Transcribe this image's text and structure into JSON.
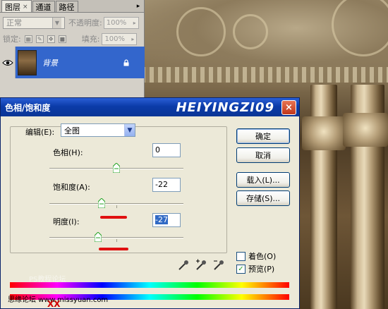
{
  "layers_panel": {
    "tabs": [
      {
        "label": "图层",
        "close": "×"
      },
      {
        "label": "通道"
      },
      {
        "label": "路径"
      }
    ],
    "blend_mode": "正常",
    "opacity_label": "不透明度:",
    "opacity_value": "100%",
    "lock_label": "锁定:",
    "fill_label": "填充:",
    "fill_value": "100%",
    "layer_name": "背景"
  },
  "dialog": {
    "title": "色相/饱和度",
    "watermark": "HEIYINGZI09",
    "close": "×",
    "edit_label": "编辑(E):",
    "edit_value": "全图",
    "hue_label": "色相(H):",
    "hue_value": "0",
    "saturation_label": "饱和度(A):",
    "saturation_value": "-22",
    "lightness_label": "明度(I):",
    "lightness_value": "-27",
    "buttons": {
      "ok": "确定",
      "cancel": "取消",
      "load": "载入(L)...",
      "save": "存储(S)..."
    },
    "colorize_label": "着色(O)",
    "colorize_checked": false,
    "preview_label": "预览(P)",
    "preview_checked": true,
    "slider_levels": {
      "hue": 0.5,
      "saturation": 0.39,
      "lightness": 0.365
    }
  },
  "overlay": {
    "faint_text": "PS教程论坛",
    "site_text": "思缘论坛 www.missyuan.com",
    "red_marks": "XX"
  },
  "colors": {
    "titlebar": "#0b3ba8",
    "selection": "#3366cc",
    "annotation_red": "#e01010"
  }
}
